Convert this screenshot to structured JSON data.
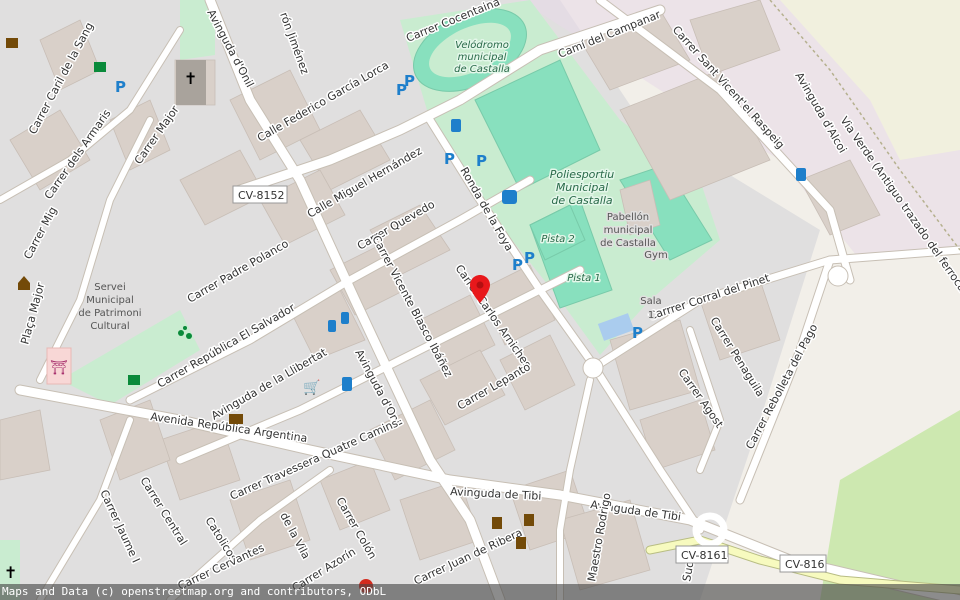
{
  "map": {
    "attribution": "Maps and Data (c) openstreetmap.org and contributors, ODbL",
    "colors": {
      "land": "#f2efe9",
      "residential": "#e0dfdf",
      "park": "#c9ecd0",
      "pitch": "#88e0be",
      "building": "#d9d0c9",
      "road": "#ffffff",
      "secondary_road": "#f7fabf",
      "parking_icon": "#1e7fcb",
      "marker": "#e8181b",
      "religious": "#e8d4ea"
    },
    "marker": {
      "name": "location-pin-icon",
      "color": "#e8181b"
    },
    "streets": {
      "carril_de_la_sang": "Carrer Caril de la Sang",
      "dels_armaris": "Carrer dels Armaris",
      "carrer_major": "Carrer Major",
      "carrer_mig": "Carrer Mig",
      "placa_major": "Plaça Major",
      "avinguda_onil_top": "Avinguda d'Onil",
      "garcia_lorca": "Calle Federico García Lorca",
      "cocentaina": "Carrer Cocentaina",
      "cami_campanar": "Camí del Campanar",
      "sant_vicent": "Carrer Sant Vicent'el Raspeig",
      "avinguda_alcoi": "Avinguda d'Alcoi",
      "via_verde": "Via Verde (Antiguo trazado del ferrocarril)",
      "cv8152": "CV-8152",
      "miguel_hernandez": "Calle Miguel Hernández",
      "padre_polanco": "Carrer Padre Polanco",
      "quevedo": "Carrer Quevedo",
      "ronda_foya": "Ronda de la Foya",
      "vicente_blasco": "Carrer Vicente Blasco Ibáñez",
      "carlos_arniches": "Carrer Carlos Arniches",
      "republica_salvador": "Carrer República El Salvador",
      "avinguda_llibertat": "Avinguda de la Llibertat",
      "avinguda_onil_mid": "Avinguda d'Onil",
      "lepanto": "Carrer Lepanto",
      "corral_del_pinet": "Carrrer Corral del Pinet",
      "penaguila": "Carrer Penaguila",
      "agost": "Carrer Agost",
      "rebolleta": "Carrer Rebolleta del Pago",
      "republica_argentina": "Avenida República Argentina",
      "quatre_camins": "Carrer Travessera Quatre Camins",
      "avinguda_tibi_1": "Avinguda de Tibi",
      "avinguda_tibi_2": "Avinguda de Tibi",
      "cv8161": "CV-8161",
      "cv816": "CV-816",
      "carrer_central": "Carrer Central",
      "jaume_i": "Carrer Jaume I",
      "catolicos": "Catolicos",
      "de_la_vila": "de la Vila",
      "colon": "Carrer Colón",
      "cervantes": "Carrer Cervantes",
      "azorin": "Carrer Azorín",
      "juan_de_ribera": "Carrer Juan de Ribera",
      "maestro_rodrigo": "Maestro Rodrigo",
      "sud": "Sud",
      "jimenez": "rón Jiménez"
    },
    "places": {
      "velodromo": "Velódromo municipal de Castalla",
      "poliesportiu": "Poliesportiu Municipal de Castalla",
      "pabellon": "Pabellón municipal de Castalla",
      "gym": "Gym",
      "pista2": "Pista 2",
      "pista1": "Pista 1",
      "sala1": "Sala 1",
      "servei": "Servei Municipal de Patrimoni Cultural"
    },
    "icons": [
      "parking-icon",
      "church-icon",
      "fuel-icon",
      "bus-stop-icon",
      "charging-station-icon",
      "shopping-cart-icon",
      "bank-icon",
      "museum-icon",
      "playground-icon",
      "drinking-water-icon",
      "theatre-icon",
      "police-icon",
      "fire-station-icon"
    ]
  }
}
